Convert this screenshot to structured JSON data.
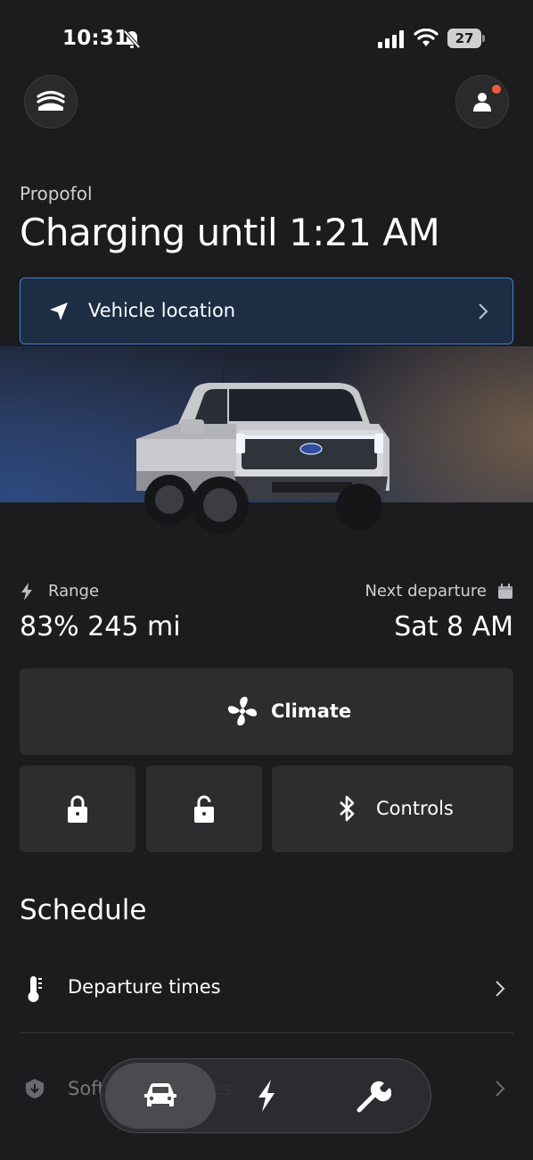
{
  "status_bar": {
    "time": "10:31",
    "battery_level": "27"
  },
  "header": {
    "vehicle_name": "Propofol",
    "charging_status": "Charging until 1:21 AM"
  },
  "location_card": {
    "label": "Vehicle location"
  },
  "stats": {
    "range_label": "Range",
    "range_value": "83% 245 mi",
    "departure_label": "Next departure",
    "departure_value": "Sat 8 AM"
  },
  "controls": {
    "climate_label": "Climate",
    "controls_label": "Controls"
  },
  "schedule": {
    "title": "Schedule",
    "items": [
      {
        "label": "Departure times",
        "icon": "thermometer-icon"
      },
      {
        "label": "Software updates",
        "icon": "shield-download-icon"
      }
    ]
  },
  "bottom_nav": {
    "items": [
      {
        "name": "vehicle",
        "icon": "car-icon",
        "active": true
      },
      {
        "name": "charging",
        "icon": "bolt-icon",
        "active": false
      },
      {
        "name": "service",
        "icon": "wrench-icon",
        "active": false
      }
    ]
  },
  "colors": {
    "background": "#1c1c1e",
    "accent_blue": "#3f7fd9",
    "notification": "#f05a40",
    "tile": "#2d2d30"
  }
}
